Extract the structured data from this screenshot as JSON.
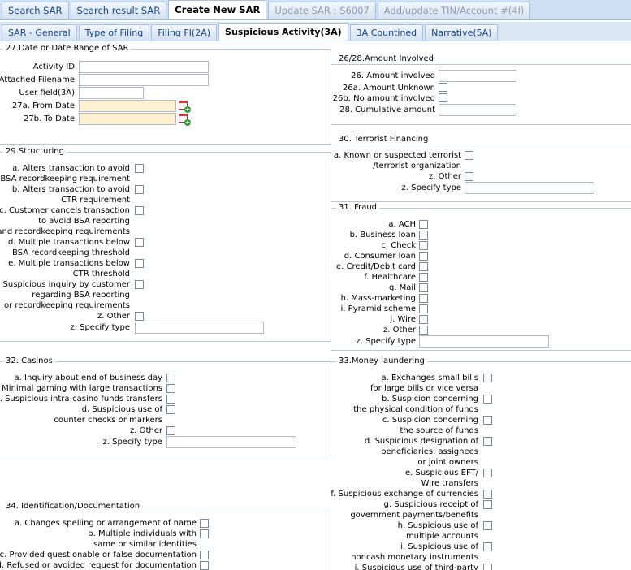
{
  "tabs_top": [
    {
      "label": "Search SAR"
    },
    {
      "label": "Search result SAR"
    },
    {
      "label": "Create New SAR"
    },
    {
      "label": "Update SAR : S6007"
    },
    {
      "label": "Add/update TIN/Account #(4I)"
    }
  ],
  "tabs_sub": [
    {
      "label": "SAR - General"
    },
    {
      "label": "Type of Filing"
    },
    {
      "label": "Filing FI(2A)"
    },
    {
      "label": "Suspicious Activity(3A)"
    },
    {
      "label": "3A Countined"
    },
    {
      "label": "Narrative(5A)"
    }
  ],
  "s27": {
    "legend": "27.Date or Date Range of SAR",
    "activity_id": "Activity ID",
    "attached": "Attached Filename",
    "user_field": "User field(3A)",
    "from": "27a. From Date",
    "to": "27b. To Date"
  },
  "s26": {
    "legend": "26/28.Amount Involved",
    "amount": "26. Amount involved",
    "unknown": "26a. Amount Unknown",
    "no_amount": "26b. No amount involved",
    "cumulative": "28. Cumulative amount"
  },
  "s29": {
    "legend": "29.Structuring",
    "lines": [
      "a. Alters transaction to avoid",
      "BSA recordkeeping requirement",
      "b. Alters transaction to avoid",
      "CTR requirement",
      "c. Customer cancels transaction",
      "to avoid BSA reporting",
      "and recordkeeping requirements",
      "d. Multiple transactions below",
      "BSA recordkeeping threshold",
      "e. Multiple transactions below",
      "CTR threshold",
      "f. Suspicious inquiry by customer",
      "regarding BSA reporting",
      "or recordkeeping requirements",
      "z. Other",
      "z. Specify type"
    ]
  },
  "s30": {
    "legend": "30. Terrorist Financing",
    "lines": [
      "a. Known or suspected terrorist",
      "/terrorist organization",
      "z. Other",
      "z. Specify type"
    ]
  },
  "s31": {
    "legend": "31. Fraud",
    "lines": [
      "a. ACH",
      "b. Business loan",
      "c. Check",
      "d. Consumer loan",
      "e. Credit/Debit card",
      "f. Healthcare",
      "g. Mail",
      "h. Mass-marketing",
      "i. Pyramid scheme",
      "j. Wire",
      "z. Other",
      "z. Specify type"
    ]
  },
  "s32": {
    "legend": "32. Casinos",
    "lines": [
      "a. Inquiry about end of business day",
      "b. Minimal gaming with large transactions",
      "c. Suspicious intra-casino funds transfers",
      "d. Suspicious use of",
      "counter checks or markers",
      "z. Other",
      "z. Specify type"
    ]
  },
  "s33": {
    "legend": "33.Money laundering",
    "lines": [
      "a. Exchanges small bills",
      "for large bills or vice versa",
      "b. Suspicion concerning",
      "the physical condition of funds",
      "c. Suspicion concerning",
      "the source of funds",
      "d. Suspicious designation of",
      "beneficiaries, assignees",
      "or joint owners",
      "e. Suspicious EFT/",
      "Wire transfers",
      "f. Suspicious exchange of currencies",
      "g. Suspicious receipt of",
      "government payments/benefits",
      "h. Suspicious use of",
      "multiple accounts",
      "i. Suspicious use of",
      "noncash monetary instruments",
      "j. Suspicious use of third-party"
    ]
  },
  "s34": {
    "legend": "34. Identification/Documentation",
    "lines": [
      "a. Changes spelling or arrangement of name",
      "b. Multiple individuals with",
      "same or similar identities",
      "c. Provided questionable or false documentation",
      "d. Refused or avoided request for documentation"
    ]
  }
}
